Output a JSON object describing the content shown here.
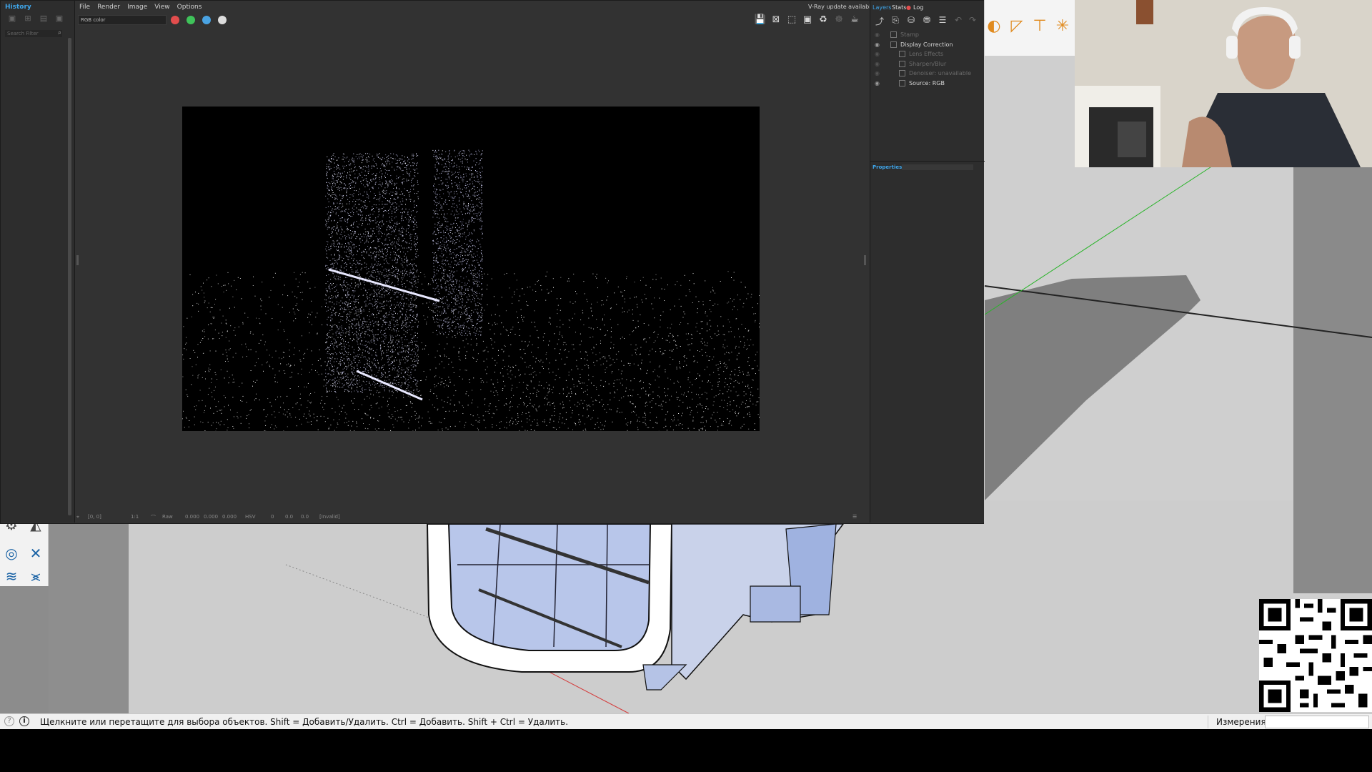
{
  "status_bar": {
    "hint": "Щелкните или перетащите для выбора объектов. Shift = Добавить/Удалить. Ctrl = Добавить. Shift + Ctrl = Удалить.",
    "measurements_label": "Измерения",
    "measurements_value": ""
  },
  "vfb": {
    "history": {
      "title": "History",
      "filter_placeholder": "Search Filter"
    },
    "menu": [
      "File",
      "Render",
      "Image",
      "View",
      "Options"
    ],
    "update_notice": "V-Ray update available",
    "channel_select": "RGB color",
    "bottom": {
      "coords": "[0, 0]",
      "zoom": "1:1",
      "mode": "Raw",
      "r": "0.000",
      "g": "0.000",
      "b": "0.000",
      "color_space": "HSV",
      "h": "0",
      "s": "0.0",
      "v": "0.0",
      "state": "[Invalid]"
    },
    "layers": {
      "tabs": [
        "Layers",
        "Stats",
        "Log"
      ],
      "items": [
        {
          "label": "Stamp",
          "enabled": false,
          "indent": 1
        },
        {
          "label": "Display Correction",
          "enabled": true,
          "indent": 1
        },
        {
          "label": "Lens Effects",
          "enabled": false,
          "indent": 2
        },
        {
          "label": "Sharpen/Blur",
          "enabled": false,
          "indent": 2
        },
        {
          "label": "Denoiser: unavailable",
          "enabled": false,
          "indent": 2
        },
        {
          "label": "Source: RGB",
          "enabled": true,
          "indent": 2
        }
      ],
      "properties_title": "Properties"
    }
  },
  "colors": {
    "vray_accent": "#3ea4e8",
    "sketchup_tool_blue": "#1c64a6",
    "sketchup_tool_orange": "#e08a1e"
  }
}
